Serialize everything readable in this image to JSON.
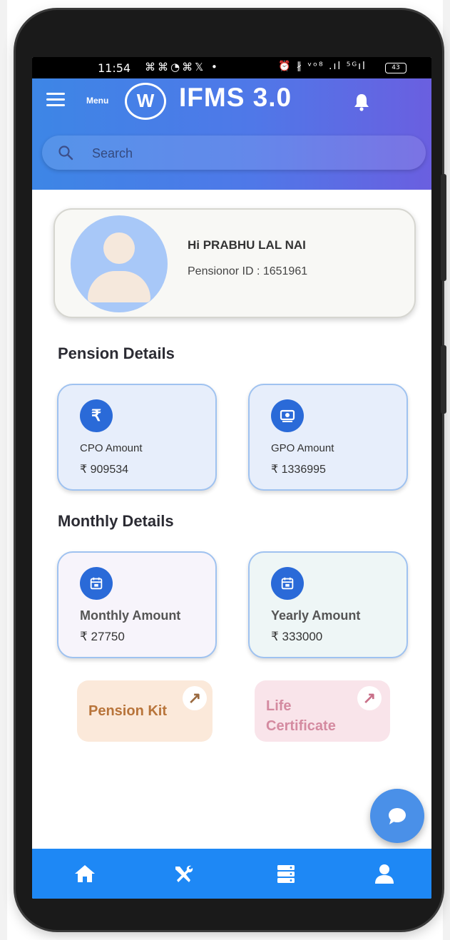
{
  "status_bar": {
    "time": "11:54",
    "left_icons": "⌘⌘◔⌘𝕏 •",
    "right_icons": "⏰ ∦ ᵛᵒ⁸ .ıl ⁵ᴳıl",
    "battery": "43"
  },
  "header": {
    "menu_label": "Menu",
    "logo_text": "W",
    "app_title": "IFMS 3.0"
  },
  "search": {
    "placeholder": "Search"
  },
  "profile": {
    "greeting": "Hi PRABHU LAL NAI",
    "pension_id": "Pensionor ID : 1651961"
  },
  "pension_details": {
    "title": "Pension Details",
    "cards": [
      {
        "label": "CPO Amount",
        "value": "₹ 909534",
        "icon": "rupee-icon"
      },
      {
        "label": "GPO Amount",
        "value": "₹ 1336995",
        "icon": "cash-icon"
      }
    ]
  },
  "monthly_details": {
    "title": "Monthly Details",
    "cards": [
      {
        "label": "Monthly Amount",
        "value": "₹ 27750",
        "icon": "calendar-icon"
      },
      {
        "label": "Yearly Amount",
        "value": "₹ 333000",
        "icon": "calendar-icon"
      }
    ]
  },
  "quick_links": [
    {
      "label": "Pension Kit",
      "icon": "arrow-up-right-icon"
    },
    {
      "label": "Life\nCertificate",
      "icon": "arrow-up-right-icon"
    }
  ],
  "bottom_nav": [
    "home-icon",
    "tools-icon",
    "server-icon",
    "user-icon"
  ],
  "colors": {
    "header_start": "#3d86e6",
    "header_end": "#6a5fe0",
    "primary": "#2a6ad8",
    "bottom_nav": "#1e88f5",
    "pension_kit_bg": "#fbe9da",
    "pension_kit_text": "#b8743a",
    "life_cert_bg": "#f9e4ea",
    "life_cert_text": "#d48aa0"
  }
}
